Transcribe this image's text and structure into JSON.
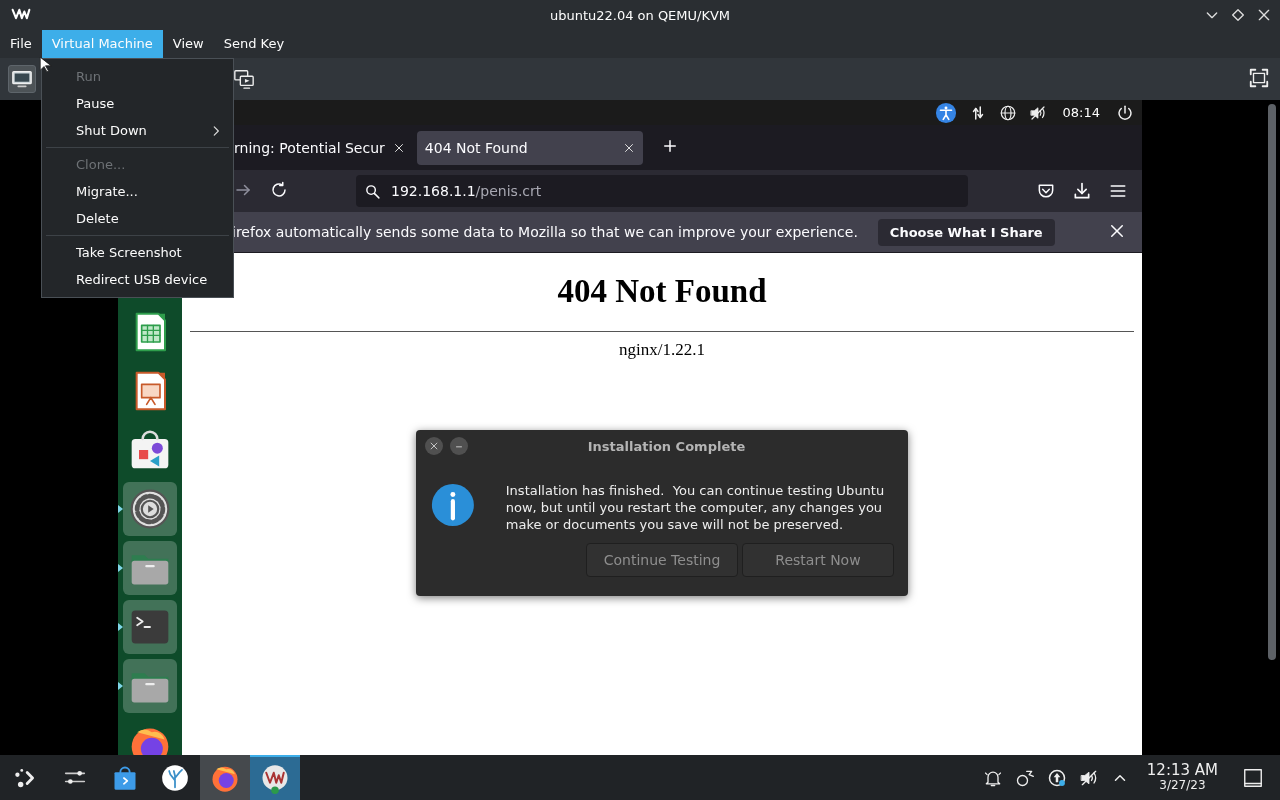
{
  "window": {
    "title": "ubuntu22.04 on QEMU/KVM"
  },
  "menubar": [
    {
      "label": "File",
      "selected": false
    },
    {
      "label": "Virtual Machine",
      "selected": true
    },
    {
      "label": "View",
      "selected": false
    },
    {
      "label": "Send Key",
      "selected": false
    }
  ],
  "menu": {
    "groups": [
      [
        {
          "label": "Run",
          "disabled": true,
          "submenu": false
        },
        {
          "label": "Pause",
          "disabled": false,
          "submenu": false
        },
        {
          "label": "Shut Down",
          "disabled": false,
          "submenu": true
        }
      ],
      [
        {
          "label": "Clone...",
          "disabled": true,
          "submenu": false
        },
        {
          "label": "Migrate...",
          "disabled": false,
          "submenu": false
        },
        {
          "label": "Delete",
          "disabled": false,
          "submenu": false
        }
      ],
      [
        {
          "label": "Take Screenshot",
          "disabled": false,
          "submenu": false
        },
        {
          "label": "Redirect USB device",
          "disabled": false,
          "submenu": false
        }
      ]
    ]
  },
  "toolbar": [
    {
      "kind": "console",
      "selected": true
    },
    {
      "kind": "snapshots",
      "selected": false
    }
  ],
  "guest": {
    "top_bar": {
      "time": "08:14"
    },
    "dock": [
      {
        "kind": "spreadsheet",
        "running": false
      },
      {
        "kind": "presentation",
        "running": false
      },
      {
        "kind": "store",
        "running": false
      },
      {
        "kind": "settings",
        "running": true
      },
      {
        "kind": "files",
        "running": true
      },
      {
        "kind": "terminal",
        "running": true
      },
      {
        "kind": "files-alt",
        "running": true
      },
      {
        "kind": "browser",
        "running": false
      }
    ],
    "browser": {
      "tabs": [
        {
          "title": "rning: Potential Secur",
          "selected": false
        },
        {
          "title": "404 Not Found",
          "selected": true
        }
      ],
      "url": {
        "host": "192.168.1.1",
        "path": "/penis.crt"
      },
      "notification": {
        "text": "irefox automatically sends some data to Mozilla so that we can improve your experience.",
        "button": "Choose What I Share"
      },
      "page": {
        "heading": "404 Not Found",
        "footer": "nginx/1.22.1"
      }
    },
    "dialog": {
      "title": "Installation Complete",
      "message": "Installation has finished.  You can continue testing Ubuntu now, but until you restart the computer, any changes you make or documents you save will not be preserved.",
      "buttons": [
        "Continue Testing",
        "Restart Now"
      ]
    }
  },
  "taskbar": {
    "launchers": [
      {
        "kind": "launcher"
      },
      {
        "kind": "sliders"
      },
      {
        "kind": "store"
      },
      {
        "kind": "coral"
      }
    ],
    "tasks": [
      {
        "kind": "browser",
        "selected": false
      },
      {
        "kind": "vm",
        "selected": true
      }
    ],
    "clock": {
      "time": "12:13 AM",
      "date": "3/27/23"
    }
  }
}
